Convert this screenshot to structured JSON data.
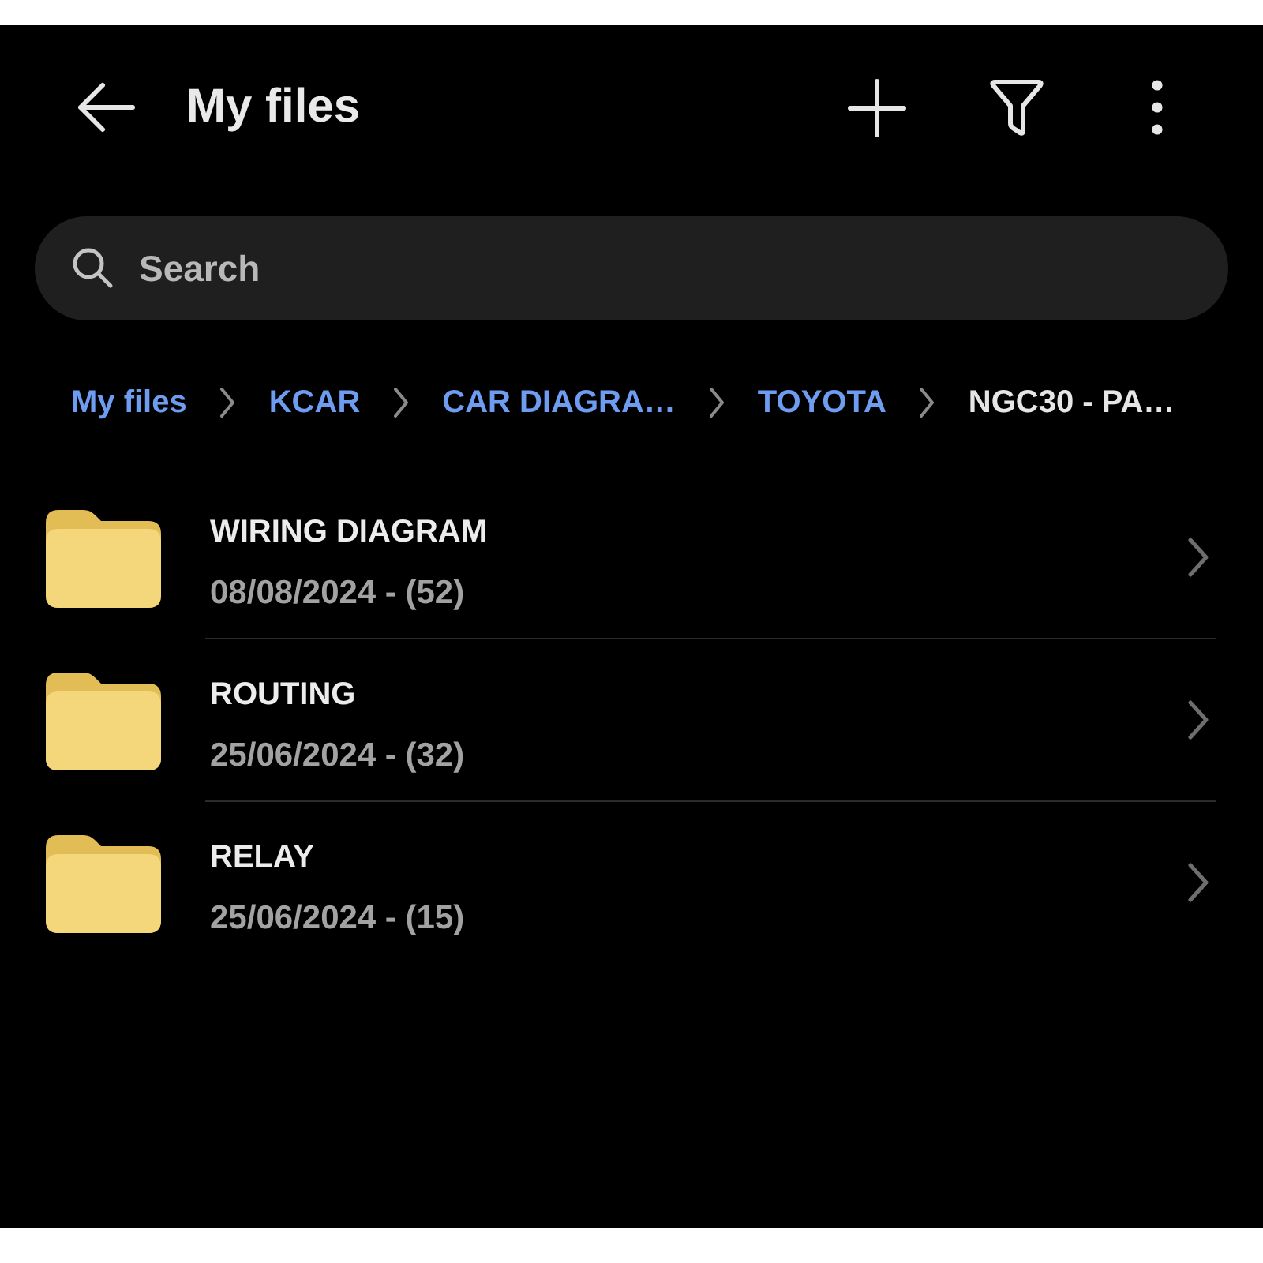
{
  "header": {
    "title": "My files"
  },
  "search": {
    "placeholder": "Search"
  },
  "breadcrumbs": [
    {
      "label": "My files",
      "current": false
    },
    {
      "label": "KCAR",
      "current": false
    },
    {
      "label": "CAR DIAGRA…",
      "current": false
    },
    {
      "label": "TOYOTA",
      "current": false
    },
    {
      "label": "NGC30 - PA…",
      "current": true
    }
  ],
  "folders": [
    {
      "name": "WIRING DIAGRAM",
      "details": "08/08/2024 - (52)"
    },
    {
      "name": "ROUTING",
      "details": "25/06/2024 - (32)"
    },
    {
      "name": "RELAY",
      "details": "25/06/2024 - (15)"
    }
  ]
}
